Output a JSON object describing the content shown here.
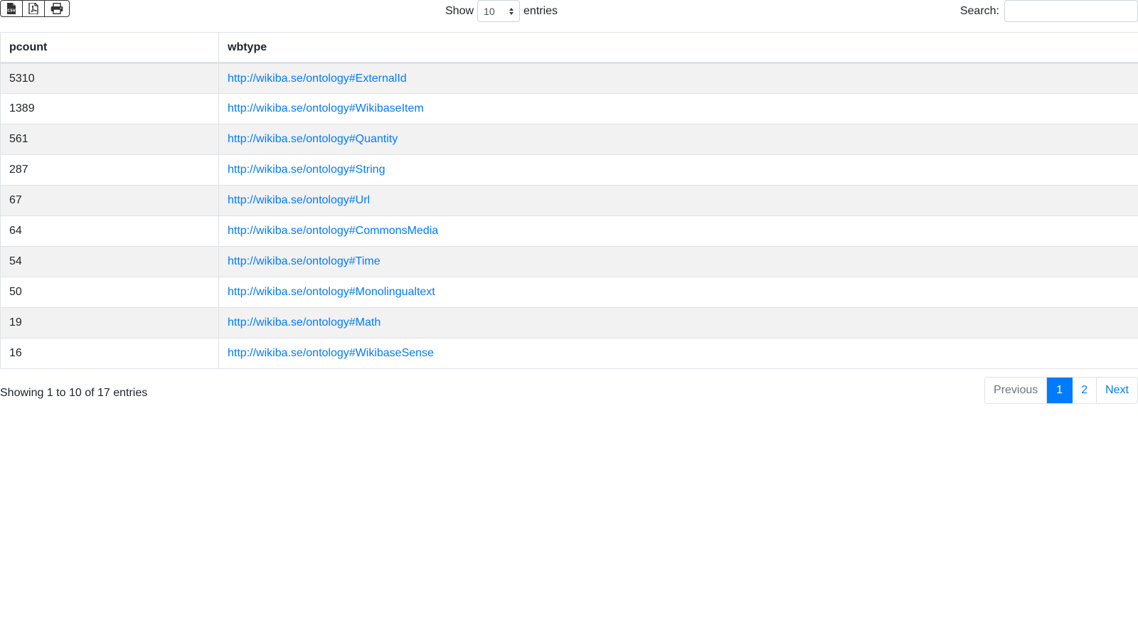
{
  "toolbar": {
    "export_buttons": [
      {
        "icon": "csv-file-icon"
      },
      {
        "icon": "pdf-file-icon"
      },
      {
        "icon": "print-icon"
      }
    ],
    "length_label_before": "Show",
    "length_value": "10",
    "length_label_after": "entries",
    "search_label": "Search:",
    "search_value": "",
    "search_placeholder": ""
  },
  "table": {
    "columns": [
      "pcount",
      "wbtype"
    ],
    "rows": [
      {
        "pcount": "5310",
        "wbtype": "http://wikiba.se/ontology#ExternalId"
      },
      {
        "pcount": "1389",
        "wbtype": "http://wikiba.se/ontology#WikibaseItem"
      },
      {
        "pcount": "561",
        "wbtype": "http://wikiba.se/ontology#Quantity"
      },
      {
        "pcount": "287",
        "wbtype": "http://wikiba.se/ontology#String"
      },
      {
        "pcount": "67",
        "wbtype": "http://wikiba.se/ontology#Url"
      },
      {
        "pcount": "64",
        "wbtype": "http://wikiba.se/ontology#CommonsMedia"
      },
      {
        "pcount": "54",
        "wbtype": "http://wikiba.se/ontology#Time"
      },
      {
        "pcount": "50",
        "wbtype": "http://wikiba.se/ontology#Monolingualtext"
      },
      {
        "pcount": "19",
        "wbtype": "http://wikiba.se/ontology#Math"
      },
      {
        "pcount": "16",
        "wbtype": "http://wikiba.se/ontology#WikibaseSense"
      }
    ]
  },
  "footer": {
    "info": "Showing 1 to 10 of 17 entries",
    "pagination": {
      "previous": "Previous",
      "pages": [
        "1",
        "2"
      ],
      "active_page": "1",
      "next": "Next"
    }
  },
  "colors": {
    "link": "#007bff",
    "active_page_bg": "#007bff",
    "stripe": "#f2f2f2",
    "border": "#dee2e6"
  }
}
